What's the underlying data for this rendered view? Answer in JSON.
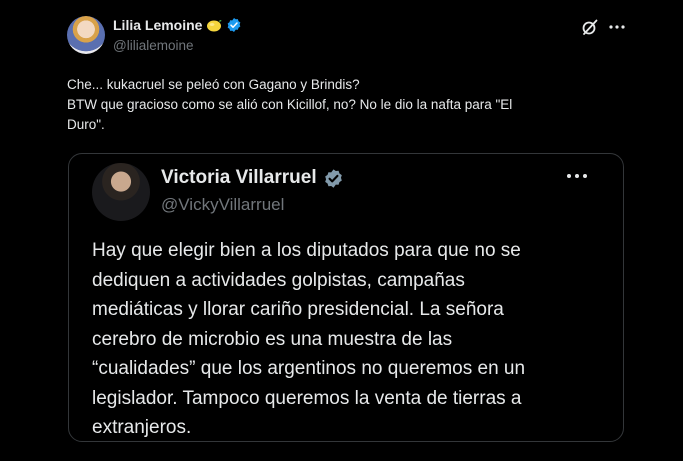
{
  "tweet": {
    "author_name": "Lilia Lemoine",
    "author_handle": "@lilialemoine",
    "body_lines": [
      "Che... kukacruel se peleó con Gagano y Brindis?",
      "BTW que gracioso como se alió con Kicillof, no? No le dio la nafta para \"El",
      "Duro\"."
    ]
  },
  "quote": {
    "author_name": "Victoria Villarruel",
    "author_handle": "@VickyVillarruel",
    "body_lines": [
      "Hay que elegir bien a los diputados para que no se",
      "dediquen a actividades golpistas, campañas",
      "mediáticas y llorar cariño presidencial. La señora",
      "cerebro de microbio es una muestra de las",
      "“cualidades” que los argentinos no queremos en un",
      "legislador. Tampoco queremos la venta de tierras a",
      "extranjeros."
    ]
  },
  "icons": {
    "author_badge_emoji": "lemon-emoji-icon",
    "verified": "verified-badge-icon",
    "grok": "grok-icon",
    "more": "more-icon"
  },
  "colors": {
    "background": "#000000",
    "text": "#e7e9ea",
    "secondary_text": "#71767b",
    "verified_blue": "#1d9bf0",
    "verified_gray": "#829aab",
    "border": "#333639"
  }
}
